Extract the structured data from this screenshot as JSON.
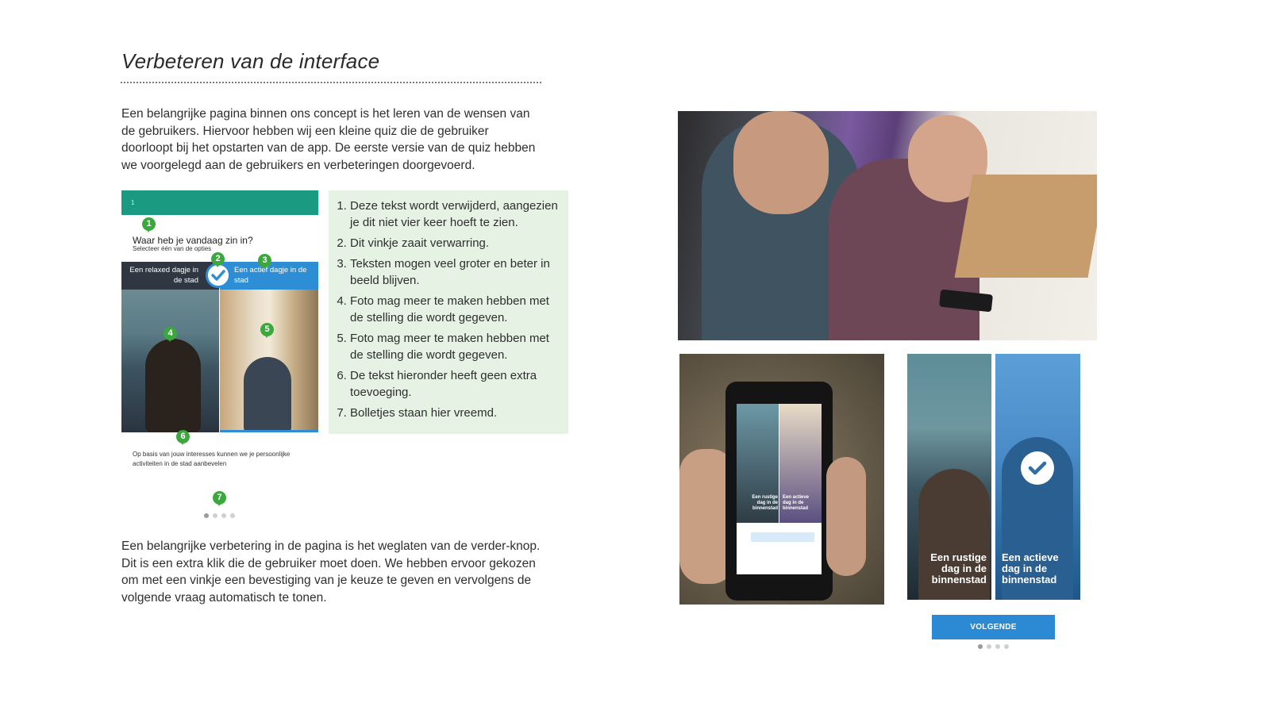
{
  "heading": "Verbeteren van de interface",
  "intro": "Een belangrijke pagina binnen ons concept is het leren van de wensen van de gebruikers. Hiervoor hebben wij een kleine quiz die de gebruiker doorloopt bij het opstarten van de app. De eerste versie van de quiz hebben we voorgelegd aan de gebruikers en verbeteringen doorgevoerd.",
  "quiz_v1": {
    "bar_number": "1",
    "question": "Waar heb je vandaag zin in?",
    "hint": "Selecteer één van de opties",
    "option_left": "Een relaxed dagje in de stad",
    "option_right": "Een actief dagje in de stad",
    "footer": "Op basis van jouw interesses kunnen we je persoonlijke activiteiten in de stad aanbevelen",
    "markers": [
      "1",
      "2",
      "3",
      "4",
      "5",
      "6",
      "7"
    ],
    "dots_total": 4,
    "dots_active": 1
  },
  "notes": [
    "Deze tekst wordt verwijderd, aangezien je dit niet vier keer hoeft te zien.",
    "Dit vinkje zaait verwarring.",
    "Teksten mogen veel groter en beter in beeld blijven.",
    "Foto mag meer te maken hebben met de stelling die wordt gegeven.",
    "Foto mag meer te maken hebben met de stelling die wordt gegeven.",
    "De tekst hieronder heeft geen extra toevoeging.",
    "Bolletjes staan hier vreemd."
  ],
  "outro": "Een belangrijke verbetering in de pagina is het weglaten van de verder-knop. Dit is een extra klik die de gebruiker moet doen. We hebben ervoor gekozen om met een vinkje een bevestiging van je keuze te geven en vervolgens de volgende vraag automatisch te tonen.",
  "phone_screen": {
    "left_caption": "Een rustige dag in de binnenstad",
    "right_caption": "Een actieve dag in de binnenstad"
  },
  "quiz_v2": {
    "left_caption": "Een rustige dag in de binnenstad",
    "right_caption": "Een actieve dag in de binnenstad",
    "button": "VOLGENDE",
    "dots_total": 4,
    "dots_active": 1
  },
  "colors": {
    "quiz_bar": "#1b9a82",
    "accent_blue": "#2d8ed6",
    "marker_green": "#3aa83d",
    "notes_bg": "#e6f3e4"
  }
}
